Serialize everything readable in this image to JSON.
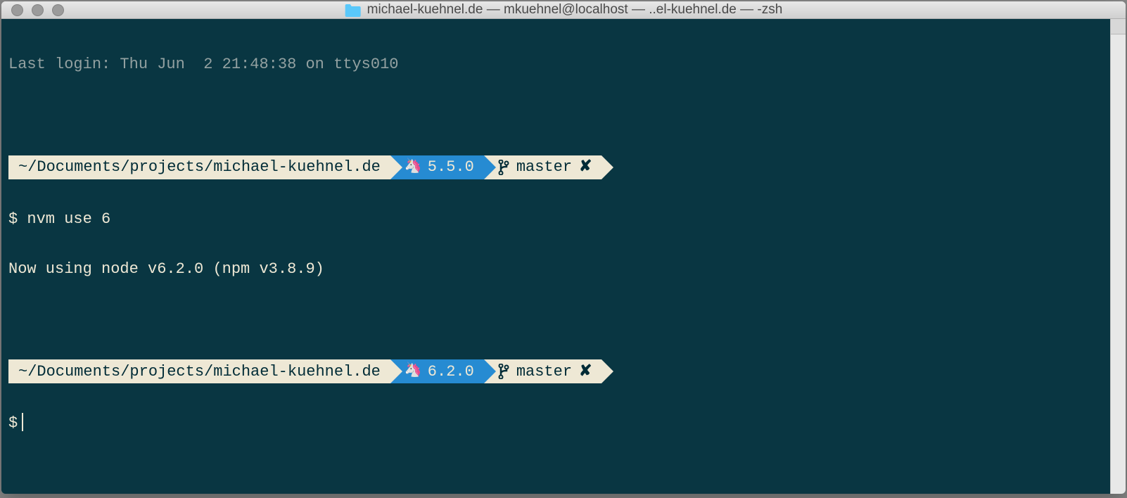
{
  "window": {
    "title": "michael-kuehnel.de — mkuehnel@localhost — ..el-kuehnel.de — -zsh"
  },
  "terminal": {
    "last_login": "Last login: Thu Jun  2 21:48:38 on ttys010",
    "prompts": [
      {
        "path": "~/Documents/projects/michael-kuehnel.de",
        "node_icon": "🦄",
        "node_version": "5.5.0",
        "git_branch": "master",
        "git_dirty_mark": "✘"
      },
      {
        "path": "~/Documents/projects/michael-kuehnel.de",
        "node_icon": "🦄",
        "node_version": "6.2.0",
        "git_branch": "master",
        "git_dirty_mark": "✘"
      }
    ],
    "command1_prefix": "$ ",
    "command1": "nvm use 6",
    "output1": "Now using node v6.2.0 (npm v3.8.9)",
    "command2_prefix": "$"
  }
}
